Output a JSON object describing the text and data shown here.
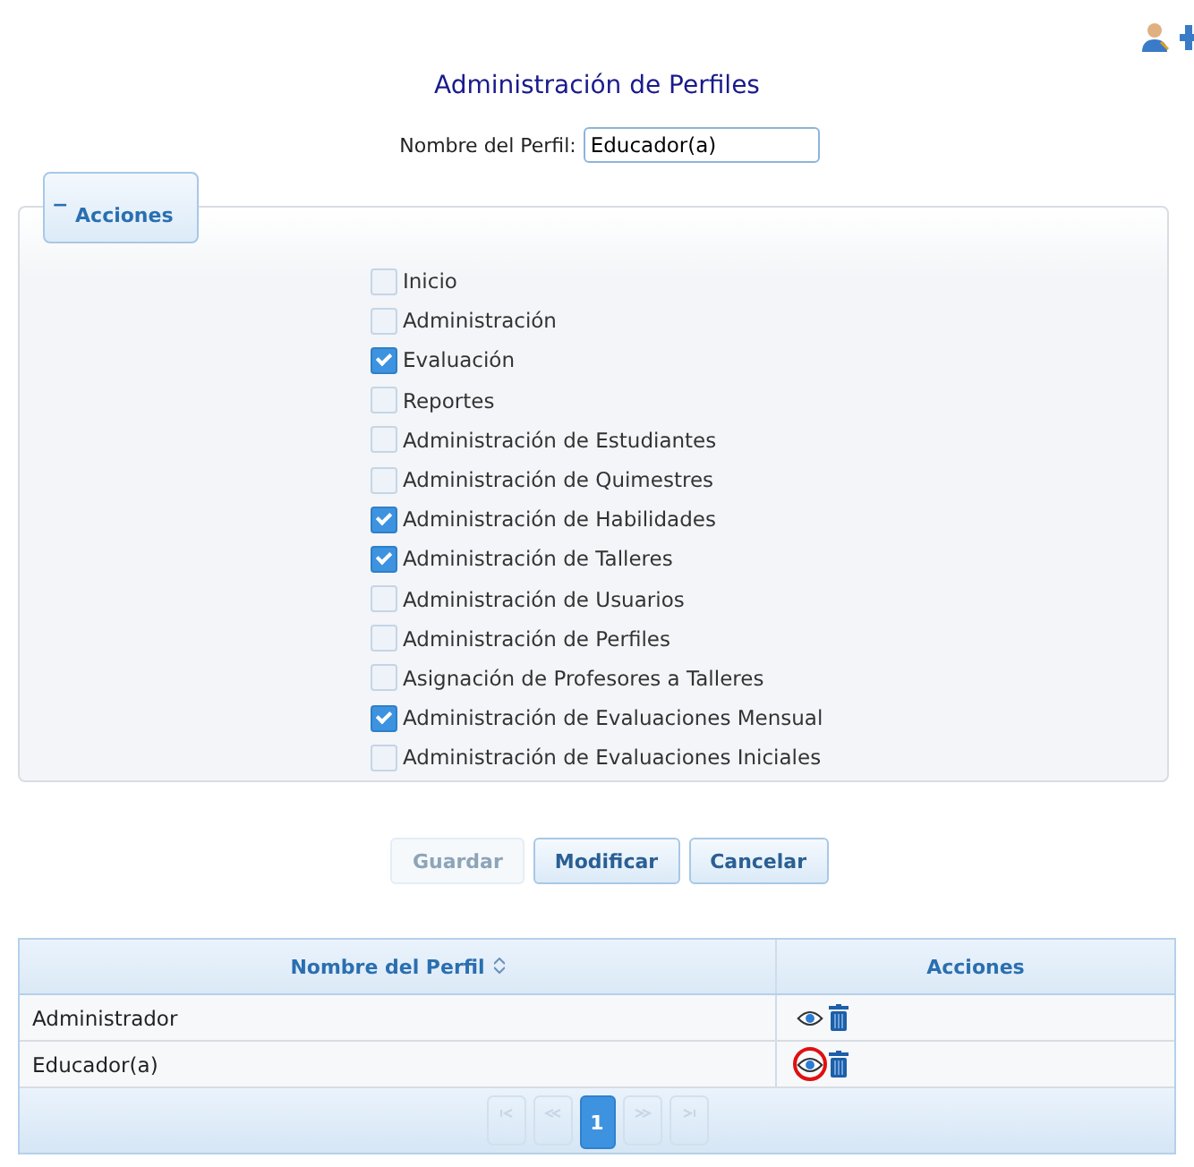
{
  "title": "Administración de Perfiles",
  "profile_field": {
    "label": "Nombre del Perfil:",
    "value": "Educador(a)"
  },
  "actions_panel": {
    "legend_symbol": "−",
    "legend": "Acciones",
    "items": [
      {
        "label": "Inicio",
        "checked": false
      },
      {
        "label": "Administración",
        "checked": false
      },
      {
        "label": "Evaluación",
        "checked": true
      },
      {
        "label": "Reportes",
        "checked": false
      },
      {
        "label": "Administración de Estudiantes",
        "checked": false
      },
      {
        "label": "Administración de Quimestres",
        "checked": false
      },
      {
        "label": "Administración de Habilidades",
        "checked": true
      },
      {
        "label": "Administración de Talleres",
        "checked": true
      },
      {
        "label": "Administración de Usuarios",
        "checked": false
      },
      {
        "label": "Administración de Perfiles",
        "checked": false
      },
      {
        "label": "Asignación de Profesores a Talleres",
        "checked": false
      },
      {
        "label": "Administración de Evaluaciones Mensual",
        "checked": true
      },
      {
        "label": "Administración de Evaluaciones Iniciales",
        "checked": false
      }
    ]
  },
  "buttons": [
    {
      "label": "Guardar",
      "disabled": true
    },
    {
      "label": "Modificar",
      "disabled": false
    },
    {
      "label": "Cancelar",
      "disabled": false
    }
  ],
  "table": {
    "columns": [
      {
        "label": "Nombre del Perfil",
        "sortable": true
      },
      {
        "label": "Acciones",
        "sortable": false
      }
    ],
    "rows": [
      {
        "name": "Administrador",
        "highlighted": false
      },
      {
        "name": "Educador(a)",
        "highlighted": true
      }
    ],
    "pager": {
      "pages": [
        {
          "label": "1",
          "selected": true
        }
      ]
    }
  }
}
